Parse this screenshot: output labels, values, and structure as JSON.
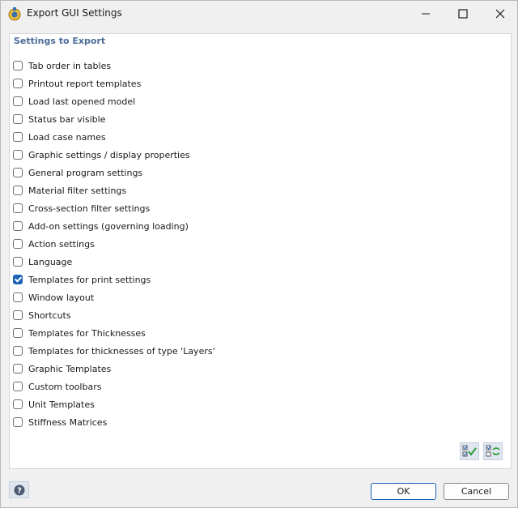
{
  "window": {
    "title": "Export GUI Settings"
  },
  "panel": {
    "section_title": "Settings to Export",
    "items": [
      {
        "label": "Tab order in tables",
        "checked": false
      },
      {
        "label": "Printout report templates",
        "checked": false
      },
      {
        "label": "Load last opened model",
        "checked": false
      },
      {
        "label": "Status bar visible",
        "checked": false
      },
      {
        "label": "Load case names",
        "checked": false
      },
      {
        "label": "Graphic settings / display properties",
        "checked": false
      },
      {
        "label": "General program settings",
        "checked": false
      },
      {
        "label": "Material filter settings",
        "checked": false
      },
      {
        "label": "Cross-section filter settings",
        "checked": false
      },
      {
        "label": "Add-on settings (governing loading)",
        "checked": false
      },
      {
        "label": "Action settings",
        "checked": false
      },
      {
        "label": "Language",
        "checked": false
      },
      {
        "label": "Templates for print settings",
        "checked": true
      },
      {
        "label": "Window layout",
        "checked": false
      },
      {
        "label": "Shortcuts",
        "checked": false
      },
      {
        "label": "Templates for Thicknesses",
        "checked": false
      },
      {
        "label": "Templates for thicknesses of type 'Layers'",
        "checked": false
      },
      {
        "label": "Graphic Templates",
        "checked": false
      },
      {
        "label": "Custom toolbars",
        "checked": false
      },
      {
        "label": "Unit Templates",
        "checked": false
      },
      {
        "label": "Stiffness Matrices",
        "checked": false
      }
    ]
  },
  "footer": {
    "ok_label": "OK",
    "cancel_label": "Cancel"
  },
  "colors": {
    "accent": "#1a62b8",
    "section_title": "#4a6c99"
  }
}
